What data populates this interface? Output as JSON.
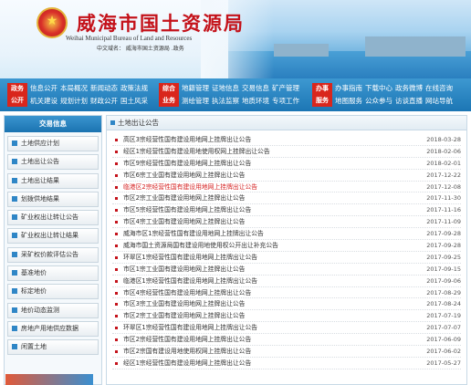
{
  "header": {
    "title": "威海市国土资源局",
    "subtitle": "Weihai Municipal Bureau of Land and Resources",
    "domain_line": "中文域名： 威海市国土资源局 .政务"
  },
  "nav": {
    "groups": [
      {
        "tag": [
          "政务",
          "公开"
        ],
        "rows": [
          [
            "信息公开",
            "本局概况",
            "新闻动态",
            "政策法规"
          ],
          [
            "机关建设",
            "规划计划",
            "财政公开",
            "国土风采"
          ]
        ]
      },
      {
        "tag": [
          "综合",
          "业务"
        ],
        "rows": [
          [
            "地籍管理",
            "证地信息",
            "交易信息",
            "矿产管理"
          ],
          [
            "测绘管理",
            "执法监察",
            "地质环境",
            "专项工作"
          ]
        ]
      },
      {
        "tag": [
          "办事",
          "服务"
        ],
        "rows": [
          [
            "办事指南",
            "下载中心",
            "政务微博",
            "在线咨询"
          ],
          [
            "地图服务",
            "公众参与",
            "访谈直播",
            "网站导航"
          ]
        ]
      }
    ]
  },
  "sidebar": {
    "title": "交易信息",
    "items": [
      "土地供应计划",
      "土地出让公告",
      "土地出让结果",
      "划拨供地结果",
      "矿业权出让转让公告",
      "矿业权出让转让结果",
      "采矿权价款评估公告",
      "基准地价",
      "标定地价",
      "地价动态监测",
      "房地产用地供应数据",
      "闲置土地"
    ]
  },
  "main": {
    "title": "土地出让公告",
    "notices": [
      {
        "title": "高区3宗经营性国有建设用地网上挂牌出让公告",
        "date": "2018-03-28",
        "highlight": false
      },
      {
        "title": "经区1宗经营性国有建设用地使用权网上挂牌出让公告",
        "date": "2018-02-06",
        "highlight": false
      },
      {
        "title": "市区9宗经营性国有建设用地网上挂牌出让公告",
        "date": "2018-02-01",
        "highlight": false
      },
      {
        "title": "市区6宗工业国有建设用地网上挂牌出让公告",
        "date": "2017-12-22",
        "highlight": false
      },
      {
        "title": "临港区2宗经营性国有建设用地网上挂牌出让公告",
        "date": "2017-12-08",
        "highlight": true
      },
      {
        "title": "市区2宗工业国有建设用地网上挂牌出让公告",
        "date": "2017-11-30",
        "highlight": false
      },
      {
        "title": "市区5宗经营性国有建设用地网上挂牌出让公告",
        "date": "2017-11-16",
        "highlight": false
      },
      {
        "title": "市区4宗工业国有建设用地网上挂牌出让公告",
        "date": "2017-11-09",
        "highlight": false
      },
      {
        "title": "威海市区1宗经营性国有建设用地网上挂牌出让公告",
        "date": "2017-09-28",
        "highlight": false
      },
      {
        "title": "威海市国土资源局国有建设用地使用权公开出让补充公告",
        "date": "2017-09-28",
        "highlight": false
      },
      {
        "title": "环翠区1宗经营性国有建设用地网上挂牌出让公告",
        "date": "2017-09-25",
        "highlight": false
      },
      {
        "title": "市区1宗工业国有建设用地网上挂牌出让公告",
        "date": "2017-09-15",
        "highlight": false
      },
      {
        "title": "临港区1宗经营性国有建设用地网上挂牌出让公告",
        "date": "2017-09-06",
        "highlight": false
      },
      {
        "title": "市区4宗经营性国有建设用地网上挂牌出让公告",
        "date": "2017-08-29",
        "highlight": false
      },
      {
        "title": "市区3宗工业国有建设用地网上挂牌出让公告",
        "date": "2017-08-24",
        "highlight": false
      },
      {
        "title": "市区2宗工业国有建设用地网上挂牌出让公告",
        "date": "2017-07-19",
        "highlight": false
      },
      {
        "title": "环翠区1宗经营性国有建设用地网上挂牌出让公告",
        "date": "2017-07-07",
        "highlight": false
      },
      {
        "title": "市区2宗经营性国有建设用地网上挂牌出让公告",
        "date": "2017-06-09",
        "highlight": false
      },
      {
        "title": "市区2宗国有建设用地使用权网上挂牌出让公告",
        "date": "2017-06-02",
        "highlight": false
      },
      {
        "title": "经区1宗经营性国有建设用地网上挂牌出让公告",
        "date": "2017-05-27",
        "highlight": false
      }
    ]
  }
}
